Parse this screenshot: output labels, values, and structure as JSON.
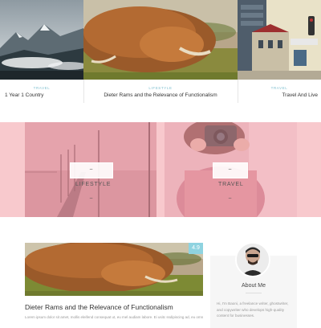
{
  "slider": {
    "slides": [
      {
        "category": "Travel",
        "title": "1 Year 1 Country"
      },
      {
        "category": "Lifestyle",
        "title": "Dieter Rams and the Relevance of Functionalism"
      },
      {
        "category": "Travel",
        "title": "Travel And Live"
      }
    ]
  },
  "categories": {
    "tiles": [
      {
        "label": "~ LIFESTYLE ~"
      },
      {
        "label": "~ TRAVEL ~"
      }
    ]
  },
  "post": {
    "badge": "4.9",
    "title": "Dieter Rams and the Relevance of Functionalism",
    "excerpt": "Lorem ipsum dolor sit amet, mollis eleifend consequat ut, eu mel audiam labore. Ei usitc ssdipiscing ad, eu omnis cerias..."
  },
  "sidebar": {
    "about_heading": "About Me",
    "bio": "Hi, I'm Baoni, a freelance writer, ghostwriter, and copywriter who develops high-quality content for businesses."
  },
  "colors": {
    "accent": "#8fd3e0",
    "pink_band": "#f8c9cd",
    "category_text": "#7fbfcf"
  }
}
